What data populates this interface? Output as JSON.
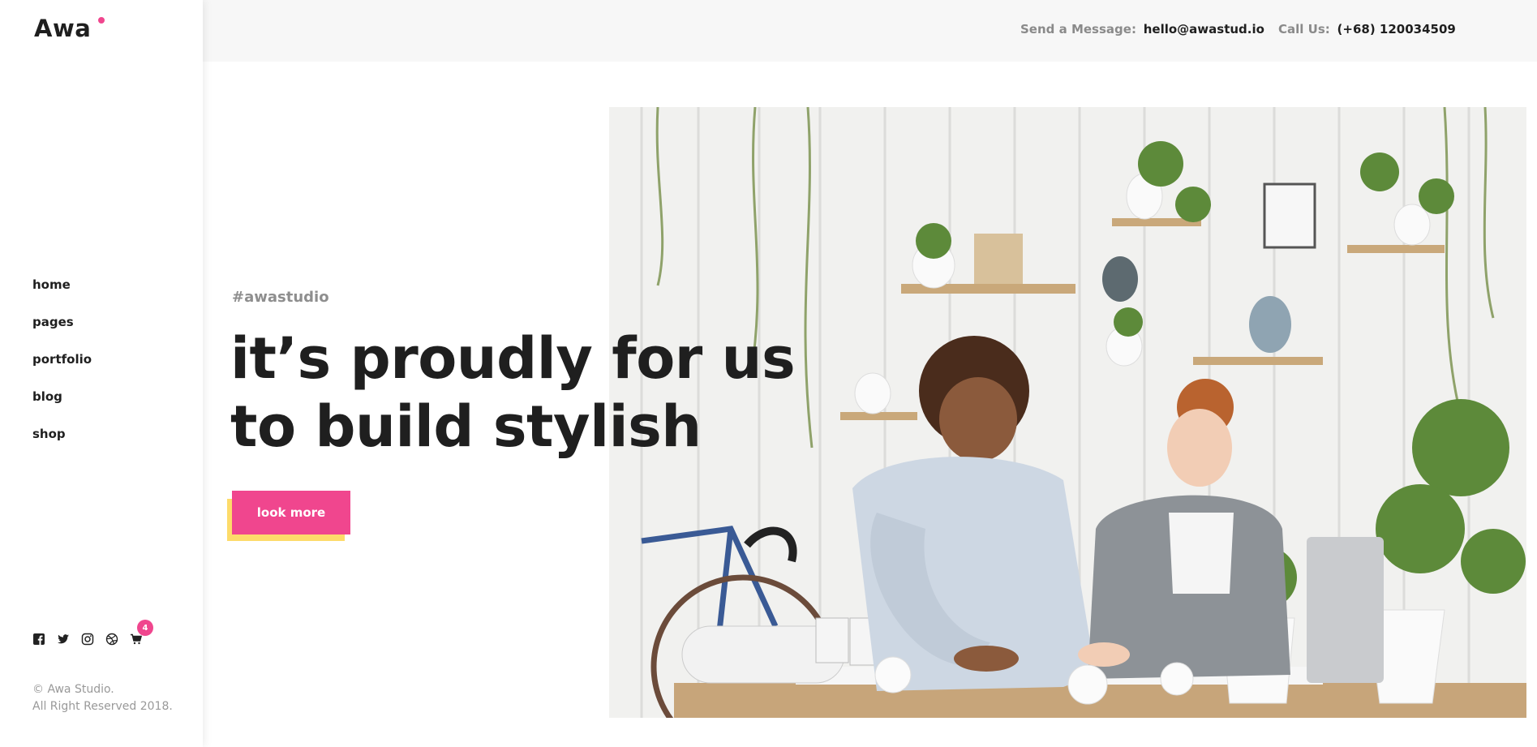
{
  "brand": {
    "logo_text": "Awa",
    "accent_color": "#f0468e",
    "secondary_color": "#fddb6a"
  },
  "nav": {
    "items": [
      {
        "label": "home"
      },
      {
        "label": "pages"
      },
      {
        "label": "portfolio"
      },
      {
        "label": "blog"
      },
      {
        "label": "shop"
      }
    ]
  },
  "social": {
    "icons": [
      "facebook-icon",
      "twitter-icon",
      "instagram-icon",
      "dribbble-icon",
      "cart-icon"
    ],
    "cart_count": "4"
  },
  "footer": {
    "copyright_line1": "© Awa Studio.",
    "copyright_line2": "All Right Reserved 2018."
  },
  "topbar": {
    "message_label": "Send a Message:",
    "message_value": "hello@awastud.io",
    "call_label": "Call Us:",
    "call_value": "(+68) 120034509"
  },
  "hero": {
    "tagline": "#awastudio",
    "headline_line1": "it’s proudly for us",
    "headline_line2": "to build stylish",
    "button_label": "look more"
  }
}
